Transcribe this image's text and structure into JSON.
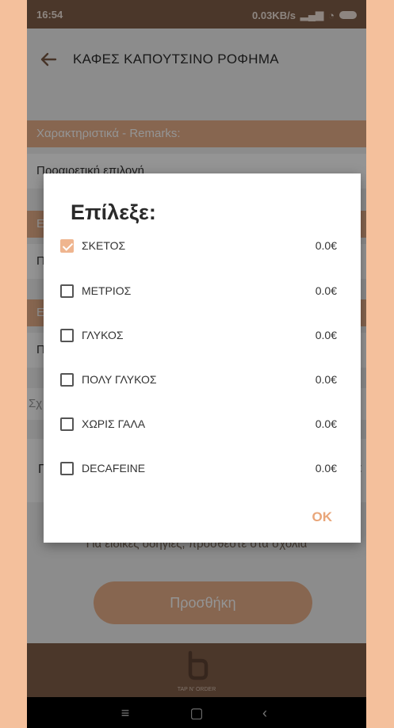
{
  "status_bar": {
    "time": "16:54",
    "speed": "0.03KB/s"
  },
  "app_bar": {
    "title": "ΚΑΦΕΣ ΚΑΠΟΥΤΣΙΝΟ ΡΟΦΗΜΑ",
    "back_icon": "arrow-left-icon"
  },
  "sections": [
    {
      "header": "Χαρακτηριστικά - Remarks:",
      "value": "Προαιρετική επιλογή"
    },
    {
      "header": "Ε",
      "value": "Πρ"
    },
    {
      "header": "Ε",
      "value": "Πρ"
    }
  ],
  "comments": {
    "placeholder": "Σχ"
  },
  "quantity_row": {
    "left": "Γ",
    "right": "€"
  },
  "note": "Για ειδικές οδηγίες, προσθέστε στα σχόλια",
  "add_button": "Προσθήκη",
  "footer": {
    "brand": "TAP N' ORDER"
  },
  "dialog": {
    "title": "Επίλεξε:",
    "options": [
      {
        "label": "ΣΚΕΤΟΣ",
        "price": "0.0€",
        "checked": true
      },
      {
        "label": "ΜΕΤΡΙΟΣ",
        "price": "0.0€",
        "checked": false
      },
      {
        "label": "ΓΛΥΚΟΣ",
        "price": "0.0€",
        "checked": false
      },
      {
        "label": "ΠΟΛΥ ΓΛΥΚΟΣ",
        "price": "0.0€",
        "checked": false
      },
      {
        "label": "ΧΩΡΙΣ ΓΑΛΑ",
        "price": "0.0€",
        "checked": false
      },
      {
        "label": "DECAFEINE",
        "price": "0.0€",
        "checked": false
      }
    ],
    "ok_label": "OK"
  },
  "colors": {
    "accent": "#e9b08a",
    "header_brown": "#825f49"
  }
}
